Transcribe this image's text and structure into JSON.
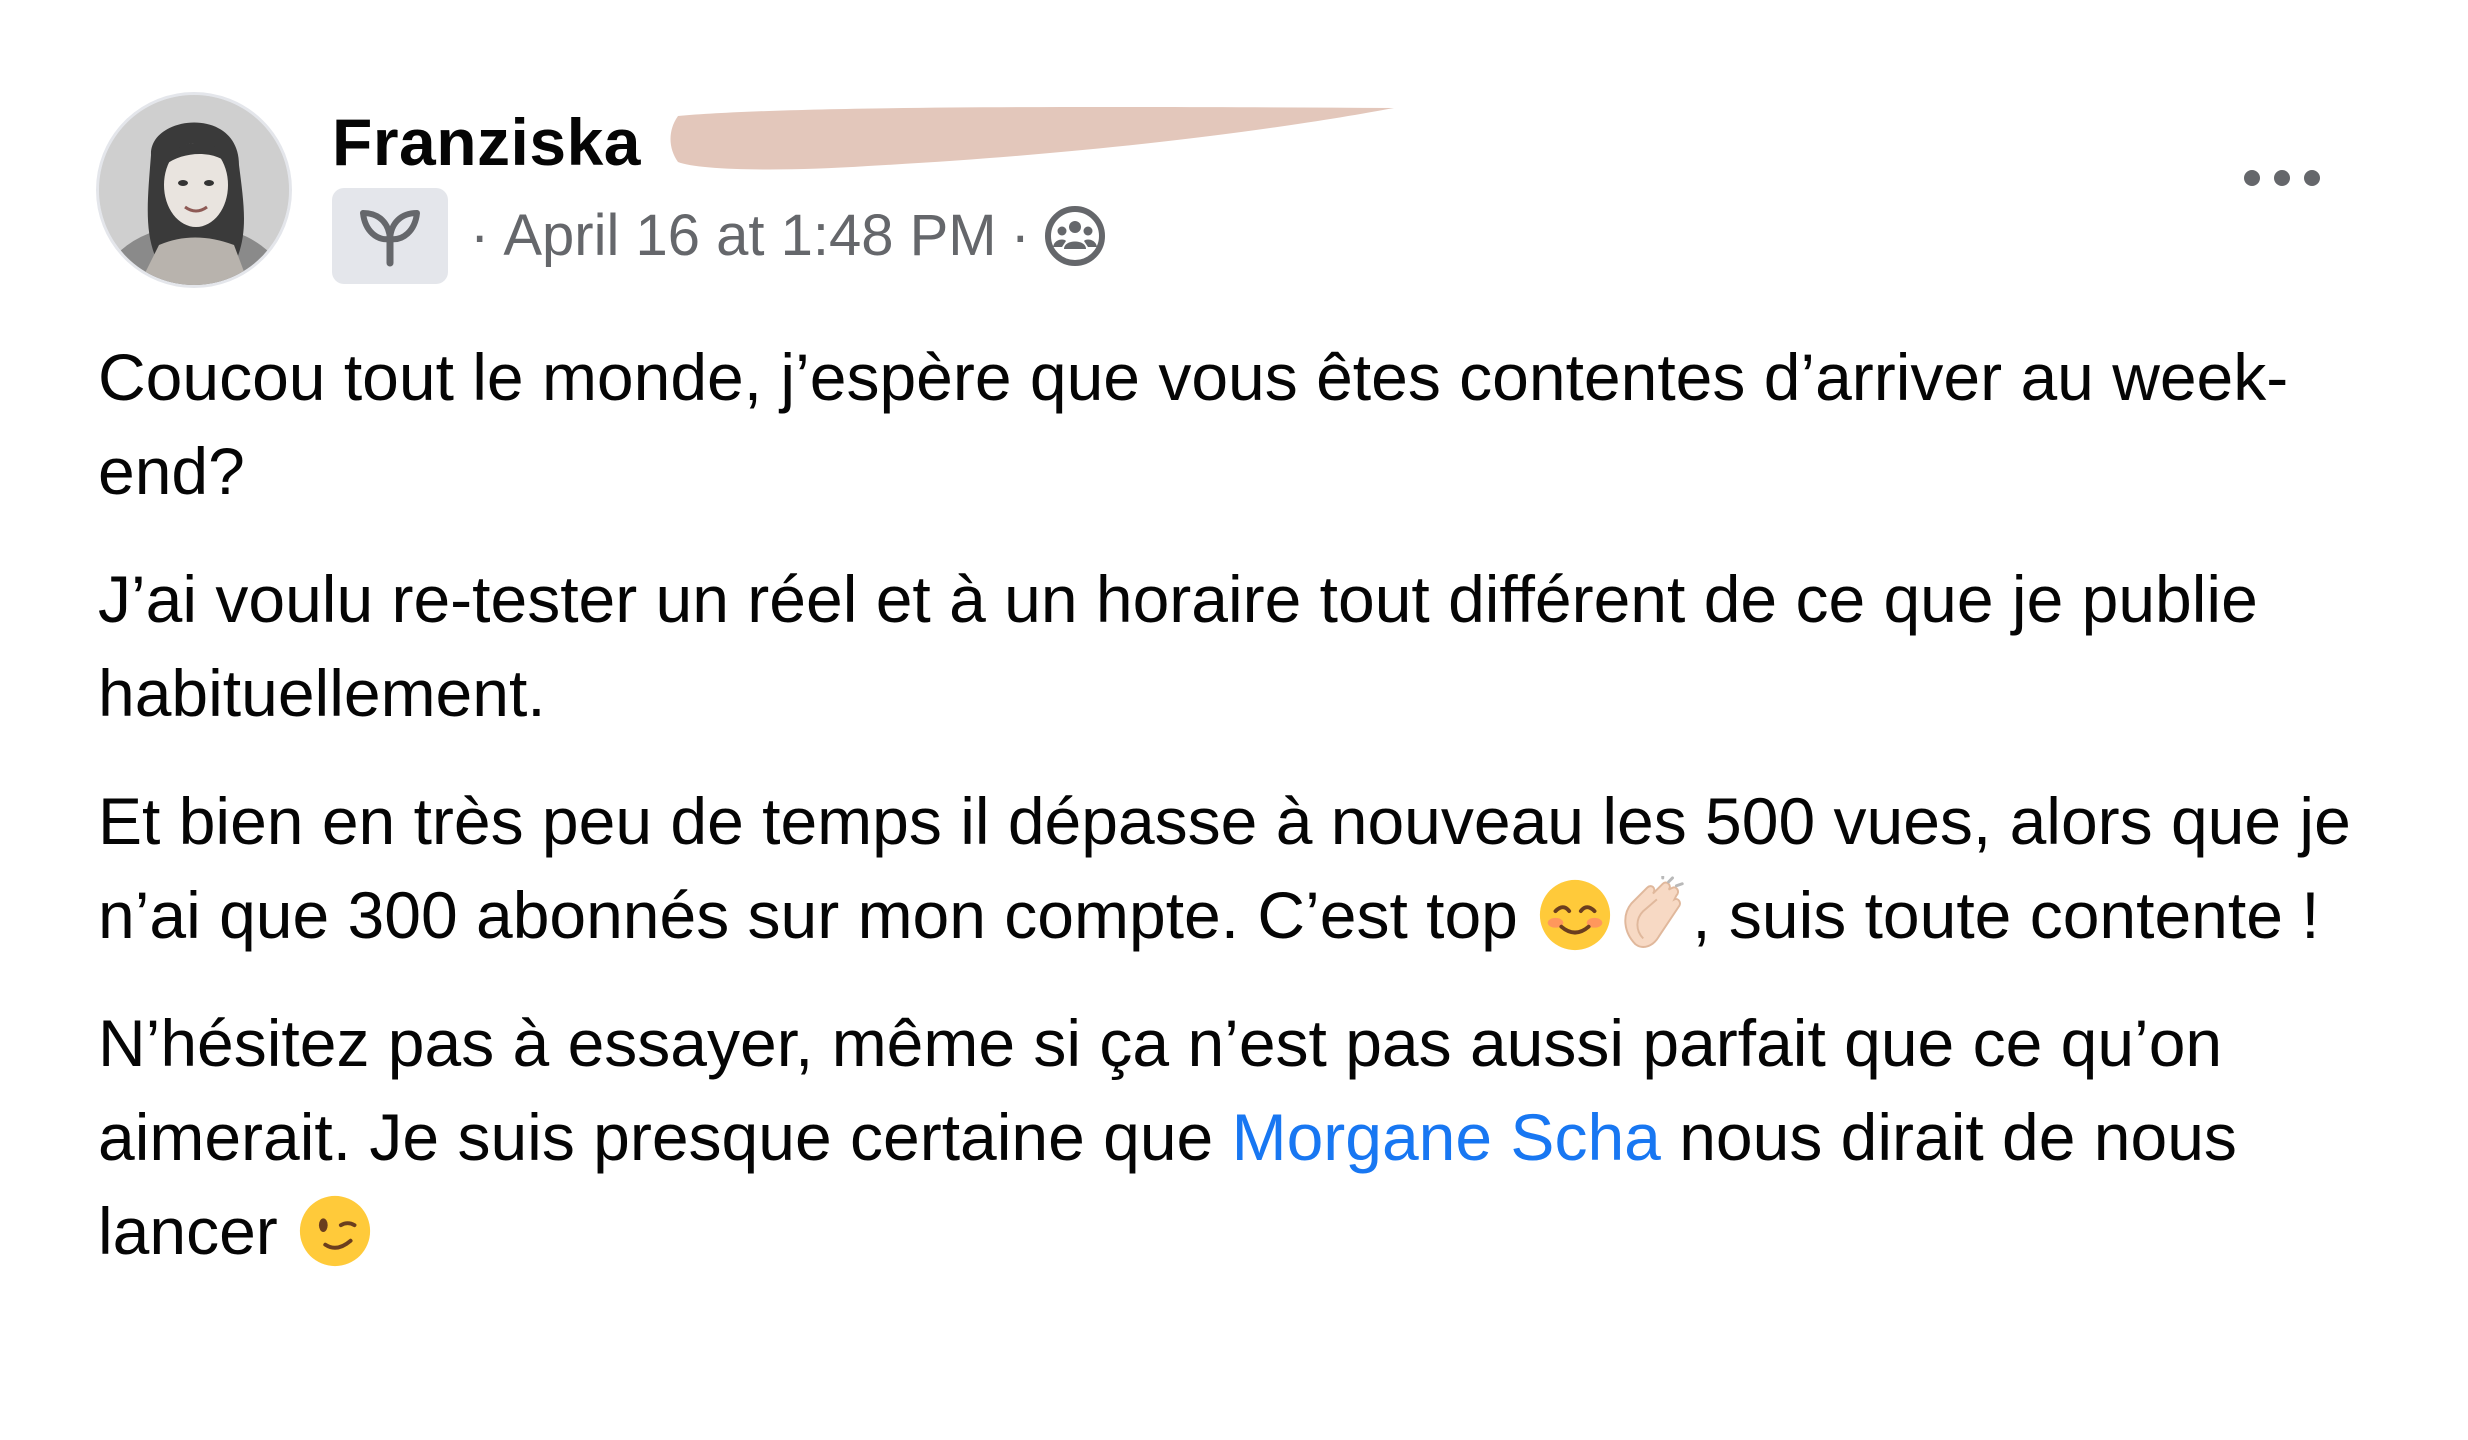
{
  "post": {
    "author_name": "Franziska",
    "timestamp": "April 16 at 1:48 PM",
    "separator": "·",
    "paragraphs": [
      {
        "text": "Coucou tout le monde, j’espère que vous êtes contentes d’arriver au week-end?"
      },
      {
        "text": "J’ai voulu re-tester un réel et à un horaire tout différent de ce que je publie habituellement."
      },
      {
        "text_before": "Et bien en très peu de temps il dépasse à nouveau les 500 vues, alors que je n’ai que 300 abonnés sur mon compte. C’est top ",
        "emojis": [
          "smiling-face-with-smiling-eyes",
          "clapping-hands"
        ],
        "text_after": ", suis toute contente !"
      },
      {
        "text_before": "N’hésitez pas à essayer, même si ça n’est pas aussi parfait que ce qu’on aimerait. Je suis presque certaine que ",
        "mention": "Morgane Scha",
        "text_after": " nous dirait de nous lancer ",
        "emoji": "winking-face"
      }
    ]
  },
  "icons": {
    "group_badge": "seedling-icon",
    "audience": "group-audience-icon",
    "more": "more-options-icon"
  },
  "colors": {
    "text": "#050505",
    "meta": "#65676b",
    "mention": "#1877f2",
    "badge_bg": "#e4e6eb",
    "redaction": "#e3c7bb"
  }
}
